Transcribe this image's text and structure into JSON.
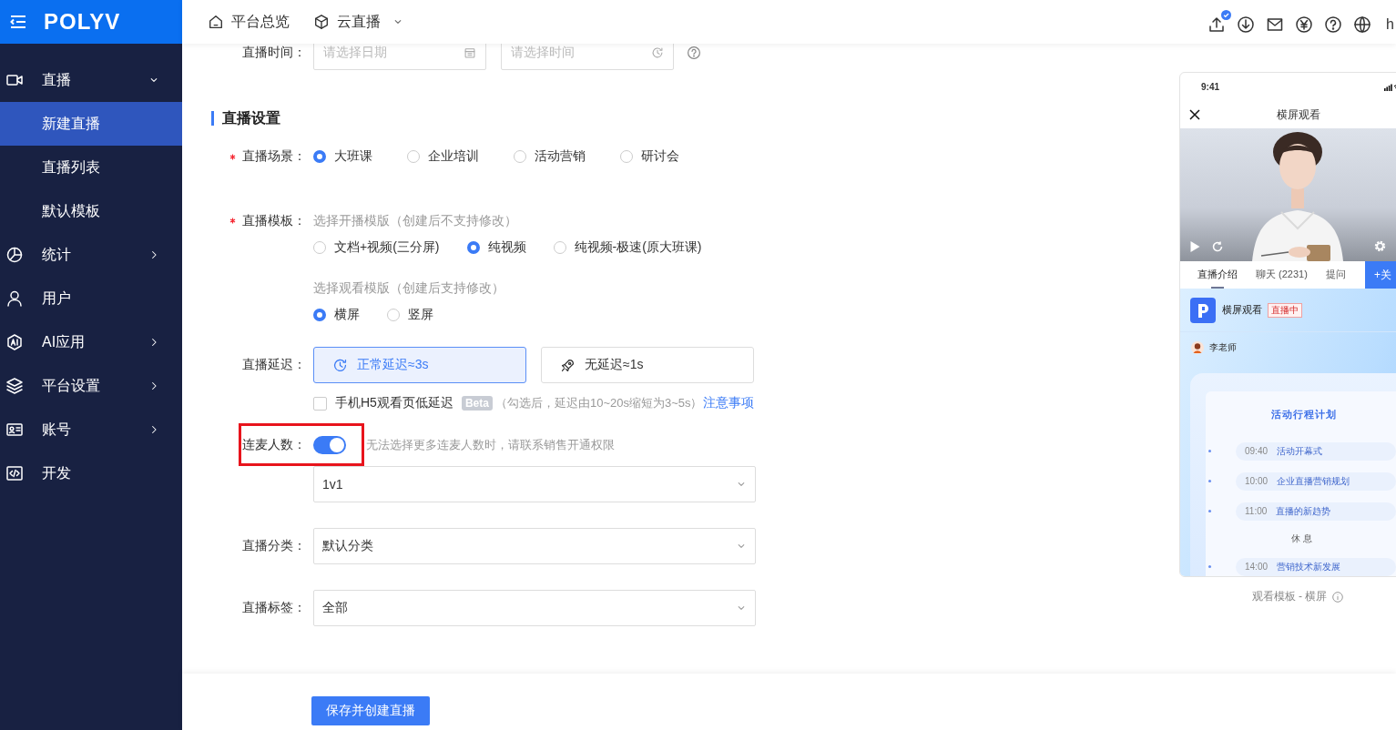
{
  "sidebar": {
    "logo": "POLYV",
    "items": [
      {
        "kind": "group",
        "label": "直播",
        "expanded": true,
        "children": [
          {
            "label": "新建直播",
            "selected": true
          },
          {
            "label": "直播列表",
            "selected": false
          },
          {
            "label": "默认模板",
            "selected": false
          }
        ]
      },
      {
        "kind": "group",
        "label": "统计",
        "expanded": false
      },
      {
        "kind": "link",
        "label": "用户"
      },
      {
        "kind": "group",
        "label": "AI应用",
        "expanded": false
      },
      {
        "kind": "group",
        "label": "平台设置",
        "expanded": false
      },
      {
        "kind": "group",
        "label": "账号",
        "expanded": false
      },
      {
        "kind": "link",
        "label": "开发"
      }
    ]
  },
  "topbar": {
    "nav": [
      {
        "label": "平台总览",
        "dropdown": false
      },
      {
        "label": "云直播",
        "dropdown": true
      }
    ],
    "tools": [
      {
        "badge": true
      },
      {
        "badge": false
      },
      {
        "badge": false
      },
      {
        "badge": false
      },
      {
        "badge": false
      },
      {
        "badge": false
      }
    ],
    "user": "h"
  },
  "form": {
    "time": {
      "label": "直播时间：",
      "date_placeholder": "请选择日期",
      "time_placeholder": "请选择时间"
    },
    "section_title": "直播设置",
    "scene": {
      "label": "直播场景：",
      "required": true,
      "options": [
        {
          "label": "大班课",
          "selected": true
        },
        {
          "label": "企业培训",
          "selected": false
        },
        {
          "label": "活动营销",
          "selected": false
        },
        {
          "label": "研讨会",
          "selected": false
        }
      ]
    },
    "template": {
      "label": "直播模板：",
      "required": true,
      "groups": [
        {
          "hint": "选择开播模版（创建后不支持修改）",
          "options": [
            {
              "label": "文档+视频(三分屏)",
              "selected": false
            },
            {
              "label": "纯视频",
              "selected": true
            },
            {
              "label": "纯视频-极速(原大班课)",
              "selected": false
            }
          ]
        },
        {
          "hint": "选择观看模版（创建后支持修改）",
          "options": [
            {
              "label": "横屏",
              "selected": true
            },
            {
              "label": "竖屏",
              "selected": false
            }
          ]
        }
      ]
    },
    "delay": {
      "label": "直播延迟：",
      "options": [
        {
          "label": "正常延迟≈3s",
          "selected": true
        },
        {
          "label": "无延迟≈1s",
          "selected": false
        }
      ],
      "low_latency": {
        "label": "手机H5观看页低延迟",
        "checked": false,
        "badge": "Beta",
        "note": "（勾选后，延迟由10~20s缩短为3~5s）",
        "link": "注意事项"
      }
    },
    "mic": {
      "label": "连麦人数：",
      "highlighted": true,
      "on": true,
      "hint": "无法选择更多连麦人数时，请联系销售开通权限",
      "value": "1v1"
    },
    "category": {
      "label": "直播分类：",
      "value": "默认分类"
    },
    "tags": {
      "label": "直播标签：",
      "value": "全部"
    }
  },
  "footer": {
    "button": "保存并创建直播"
  },
  "preview": {
    "status_time": "9:41",
    "title": "横屏观看",
    "tabs": [
      {
        "label": "直播介绍",
        "selected": true
      },
      {
        "label": "聊天 (2231)",
        "selected": false
      },
      {
        "label": "提问",
        "selected": false
      }
    ],
    "follow": "+关",
    "channel": {
      "name": "横屏观看",
      "status": "直播中"
    },
    "host": "李老师",
    "schedule": {
      "title": "活动行程计划",
      "items": [
        {
          "kind": "session",
          "time": "09:40",
          "title": "活动开幕式"
        },
        {
          "kind": "session",
          "time": "10:00",
          "title": "企业直播营销规划"
        },
        {
          "kind": "session",
          "time": "11:00",
          "title": "直播的新趋势"
        },
        {
          "kind": "break",
          "title": "休 息"
        },
        {
          "kind": "session",
          "time": "14:00",
          "title": "营销技术新发展"
        }
      ]
    },
    "caption": "观看模板 - 横屏"
  }
}
